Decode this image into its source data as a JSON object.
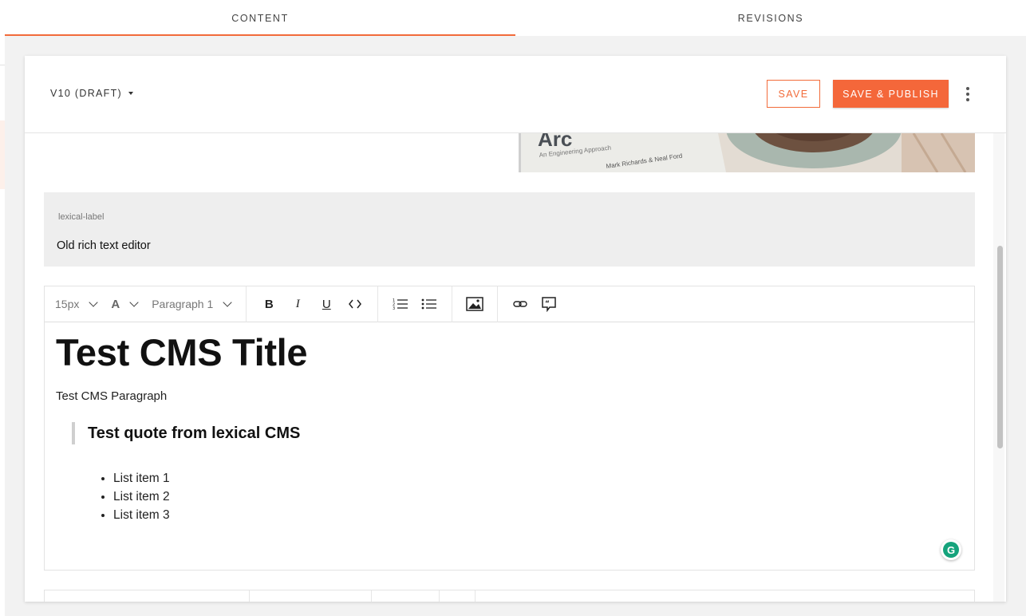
{
  "tabs": [
    {
      "label": "CONTENT",
      "active": true
    },
    {
      "label": "REVISIONS",
      "active": false
    }
  ],
  "header": {
    "version_label": "V10 (DRAFT)",
    "save_label": "SAVE",
    "publish_label": "SAVE & PUBLISH",
    "more_icon": "kebab-vertical-icon"
  },
  "image_preview": {
    "text_line1": "Arc",
    "text_line2": "An Engineering Approach",
    "text_line3": "Mark Richards & Neal Ford"
  },
  "lexical_field": {
    "label": "lexical-label",
    "value": "Old rich text editor"
  },
  "toolbar": {
    "font_size": "15px",
    "font_color_glyph": "A",
    "block_type": "Paragraph 1",
    "icons": [
      "bold-icon",
      "italic-icon",
      "underline-icon",
      "code-icon",
      "ordered-list-icon",
      "unordered-list-icon",
      "image-icon",
      "link-icon",
      "quote-comment-icon"
    ]
  },
  "editor": {
    "title": "Test CMS Title",
    "paragraph": "Test CMS Paragraph",
    "quote": "Test quote from lexical CMS",
    "list_items": [
      "List item 1",
      "List item 2",
      "List item 3"
    ]
  },
  "colors": {
    "accent": "#f26b3a",
    "publish_bg": "#f4673a",
    "grammarly": "#15a37c"
  }
}
